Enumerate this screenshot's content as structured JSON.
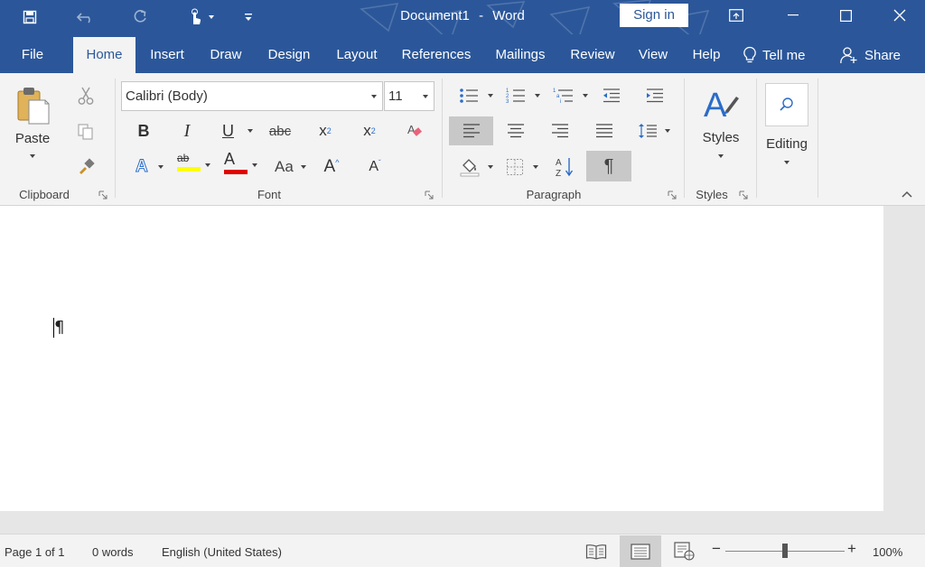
{
  "window": {
    "document_name": "Document1",
    "separator": "-",
    "app_name": "Word",
    "sign_in_label": "Sign in"
  },
  "quick_access": {
    "icons": [
      "save-icon",
      "undo-icon",
      "redo-icon",
      "touch-mode-icon",
      "customize-icon"
    ]
  },
  "tabs": [
    {
      "label": "File"
    },
    {
      "label": "Home"
    },
    {
      "label": "Insert"
    },
    {
      "label": "Draw"
    },
    {
      "label": "Design"
    },
    {
      "label": "Layout"
    },
    {
      "label": "References"
    },
    {
      "label": "Mailings"
    },
    {
      "label": "Review"
    },
    {
      "label": "View"
    },
    {
      "label": "Help"
    }
  ],
  "active_tab": "Home",
  "tell_me": {
    "label": "Tell me"
  },
  "share": {
    "label": "Share"
  },
  "ribbon": {
    "clipboard": {
      "label": "Clipboard",
      "paste_label": "Paste"
    },
    "font": {
      "label": "Font",
      "font_name": "Calibri (Body)",
      "font_size": "11",
      "bold": "B",
      "italic": "I",
      "underline": "U",
      "strikethrough": "abc",
      "subscript": "x",
      "subscript_mark": "2",
      "superscript": "x",
      "superscript_mark": "2",
      "text_effects": "A",
      "highlight": "ab",
      "font_color": "A",
      "change_case": "Aa",
      "grow_font": "A",
      "shrink_font": "A",
      "highlight_color": "#ffff00",
      "font_color_swatch": "#e00000"
    },
    "paragraph": {
      "label": "Paragraph",
      "show_marks": "¶"
    },
    "styles": {
      "label": "Styles",
      "button_label": "Styles"
    },
    "editing": {
      "button_label": "Editing"
    }
  },
  "document": {
    "paragraph_mark": "¶"
  },
  "status": {
    "page": "Page 1 of 1",
    "words": "0 words",
    "language": "English (United States)",
    "zoom_level": "100%",
    "zoom_minus": "−",
    "zoom_plus": "+"
  },
  "colors": {
    "brand_blue": "#2b579a",
    "ribbon_bg": "#f3f3f3"
  }
}
